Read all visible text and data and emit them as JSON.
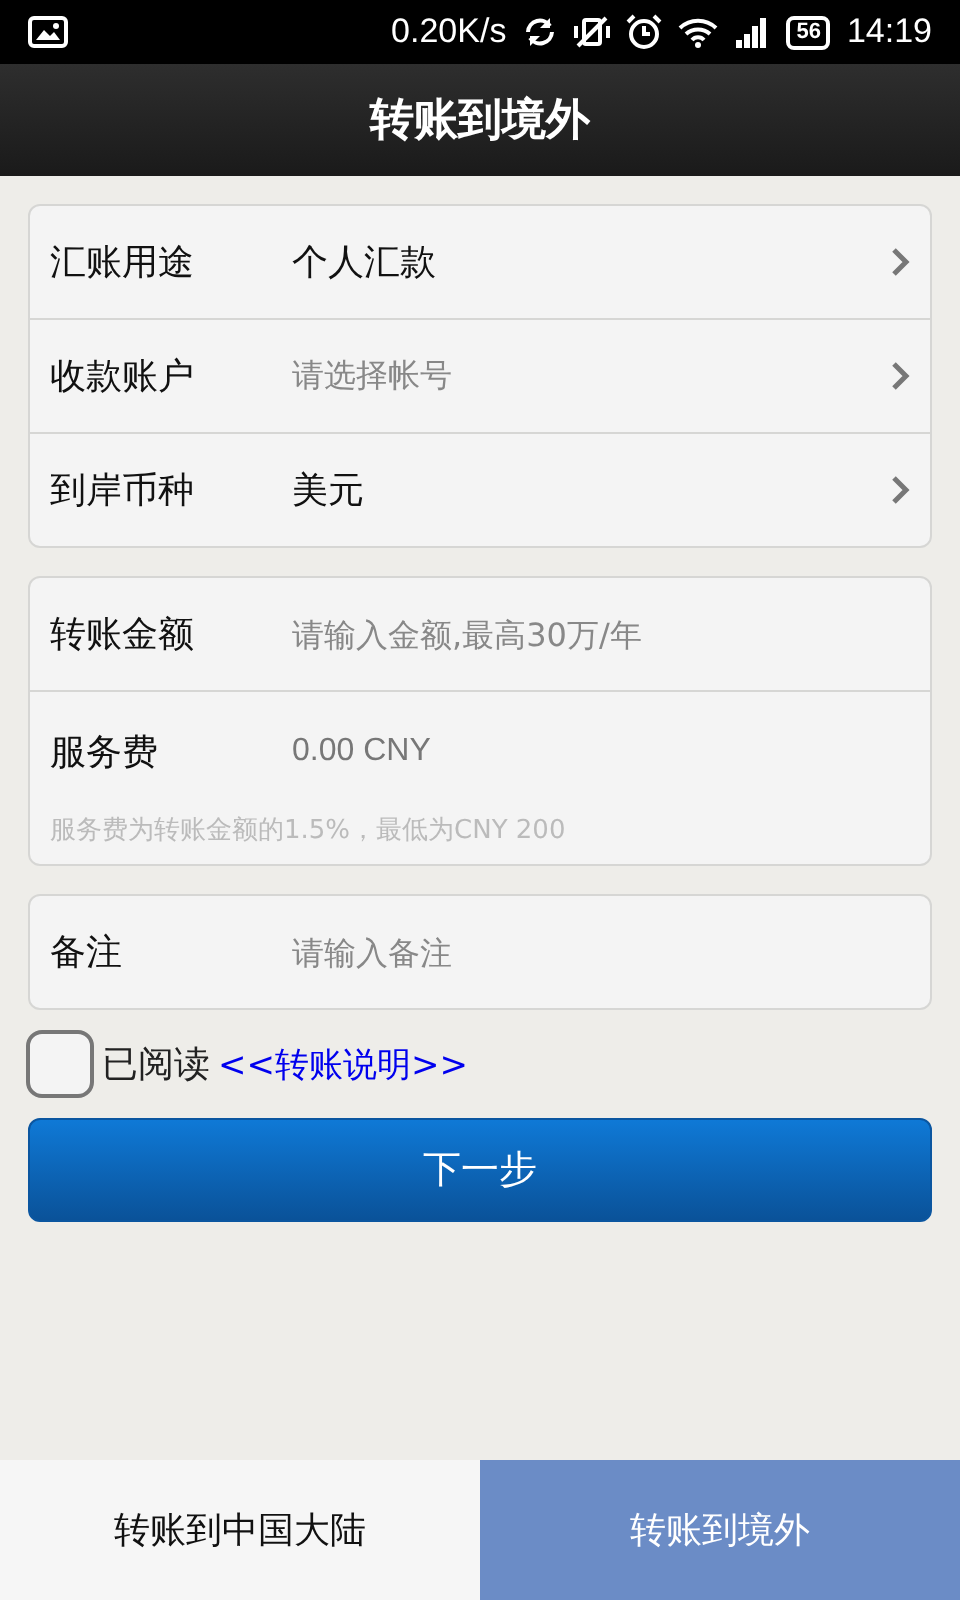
{
  "status_bar": {
    "speed": "0.20K/s",
    "battery": "56",
    "time": "14:19"
  },
  "title": "转账到境外",
  "groups": [
    {
      "rows": [
        {
          "kind": "select",
          "label": "汇账用途",
          "value": "个人汇款"
        },
        {
          "kind": "select",
          "label": "收款账户",
          "placeholder": "请选择帐号"
        },
        {
          "kind": "select",
          "label": "到岸币种",
          "value": "美元"
        }
      ]
    },
    {
      "rows": [
        {
          "kind": "input",
          "label": "转账金额",
          "placeholder": "请输入金额,最高30万/年"
        },
        {
          "kind": "fee",
          "label": "服务费",
          "value": "0.00 CNY",
          "note": "服务费为转账金额的1.5%，最低为CNY 200"
        }
      ]
    },
    {
      "rows": [
        {
          "kind": "input",
          "label": "备注",
          "placeholder": "请输入备注"
        }
      ]
    }
  ],
  "agreement": {
    "checked": false,
    "label": "已阅读",
    "link": "<<转账说明>>"
  },
  "next_button": "下一步",
  "bottom_tabs": [
    {
      "label": "转账到中国大陆",
      "selected": false
    },
    {
      "label": "转账到境外",
      "selected": true
    }
  ]
}
